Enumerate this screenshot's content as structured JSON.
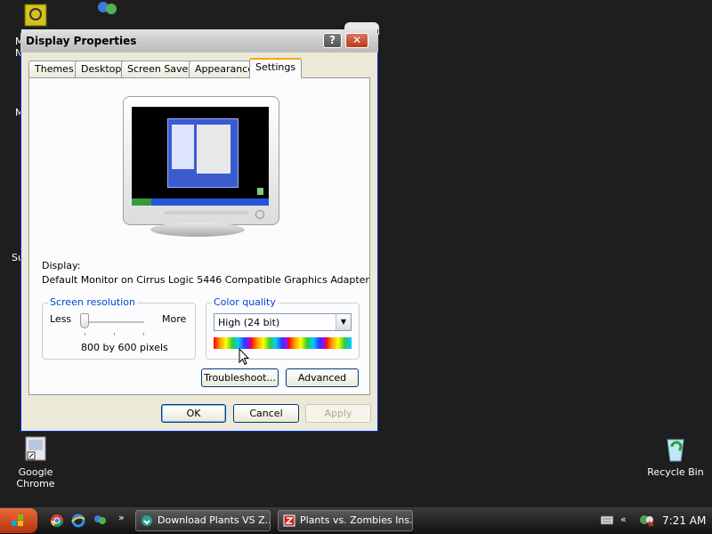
{
  "desktop": {
    "icons": [
      {
        "label": "Google Chrome",
        "icon": "chrome-shortcut-icon"
      },
      {
        "label": "Recycle Bin",
        "icon": "recycle-bin-icon"
      }
    ],
    "partial_labels": [
      "M",
      "N",
      "M",
      "Su"
    ]
  },
  "window": {
    "title": "Display Properties",
    "help_label": "?",
    "close_label": "✕",
    "tabs": [
      {
        "label": "Themes"
      },
      {
        "label": "Desktop"
      },
      {
        "label": "Screen Saver"
      },
      {
        "label": "Appearance"
      },
      {
        "label": "Settings",
        "active": true
      }
    ],
    "display_label": "Display:",
    "display_value": "Default Monitor on Cirrus Logic 5446 Compatible Graphics Adapter",
    "resolution": {
      "legend": "Screen resolution",
      "less": "Less",
      "more": "More",
      "value_text": "800 by 600 pixels",
      "slider_level": 0
    },
    "color_quality": {
      "legend": "Color quality",
      "selected": "High (24 bit)"
    },
    "buttons": {
      "troubleshoot": "Troubleshoot...",
      "advanced": "Advanced",
      "ok": "OK",
      "cancel": "Cancel",
      "apply": "Apply"
    }
  },
  "taskbar": {
    "tasks": [
      {
        "label": "Download Plants VS Z..."
      },
      {
        "label": "Plants vs. Zombies Ins..."
      }
    ],
    "quicklaunch_more": "»",
    "tray_expand": "«",
    "clock": "7:21 AM"
  },
  "colors": {
    "accent": "#0046d5",
    "active_tab": "#f9a50f",
    "start_button": "#d24a1c"
  }
}
